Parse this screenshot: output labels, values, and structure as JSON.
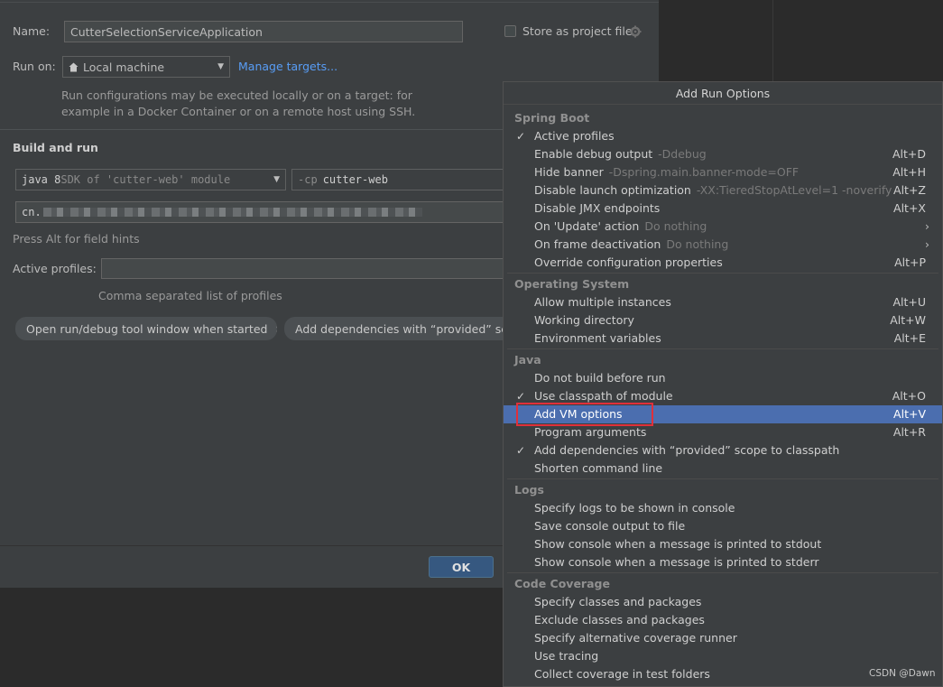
{
  "form": {
    "name_label": "Name:",
    "name_value": "CutterSelectionServiceApplication",
    "store_project_file": "Store as project file",
    "run_on_label": "Run on:",
    "run_on_value": "Local machine",
    "manage_targets": "Manage targets...",
    "run_on_hint": [
      "Run configurations may be executed locally or on a target: for",
      "example in a Docker Container or on a remote host using SSH."
    ],
    "build_and_run": "Build and run",
    "jdk_main": "java 8",
    "jdk_rest": " SDK of 'cutter-web' module",
    "cp_flag": "-cp",
    "cp_value": "cutter-web",
    "main_class_prefix": "cn.",
    "field_hint": "Press Alt for field hints",
    "active_profiles_label": "Active profiles:",
    "active_profiles_value": "",
    "profiles_hint": "Comma separated list of profiles",
    "chips": [
      "Open run/debug tool window when started",
      "Add dependencies with “provided” scope"
    ],
    "chip_close": "×",
    "ok": "OK"
  },
  "popup": {
    "title": "Add Run Options",
    "groups": [
      {
        "name": "Spring Boot",
        "items": [
          {
            "check": true,
            "label": "Active profiles",
            "hint": "",
            "shortcut": ""
          },
          {
            "check": false,
            "label": "Enable debug output",
            "hint": "-Ddebug",
            "shortcut": "Alt+D"
          },
          {
            "check": false,
            "label": "Hide banner",
            "hint": "-Dspring.main.banner-mode=OFF",
            "shortcut": "Alt+H"
          },
          {
            "check": false,
            "label": "Disable launch optimization",
            "hint": "-XX:TieredStopAtLevel=1 -noverify",
            "shortcut": "Alt+Z"
          },
          {
            "check": false,
            "label": "Disable JMX endpoints",
            "hint": "",
            "shortcut": "Alt+X"
          },
          {
            "check": false,
            "label": "On 'Update' action",
            "hint": "Do nothing",
            "shortcut": "",
            "submenu": true
          },
          {
            "check": false,
            "label": "On frame deactivation",
            "hint": "Do nothing",
            "shortcut": "",
            "submenu": true
          },
          {
            "check": false,
            "label": "Override configuration properties",
            "hint": "",
            "shortcut": "Alt+P"
          }
        ]
      },
      {
        "name": "Operating System",
        "items": [
          {
            "check": false,
            "label": "Allow multiple instances",
            "hint": "",
            "shortcut": "Alt+U"
          },
          {
            "check": false,
            "label": "Working directory",
            "hint": "",
            "shortcut": "Alt+W"
          },
          {
            "check": false,
            "label": "Environment variables",
            "hint": "",
            "shortcut": "Alt+E"
          }
        ]
      },
      {
        "name": "Java",
        "items": [
          {
            "check": false,
            "label": "Do not build before run",
            "hint": "",
            "shortcut": ""
          },
          {
            "check": true,
            "label": "Use classpath of module",
            "hint": "",
            "shortcut": "Alt+O"
          },
          {
            "check": false,
            "label": "Add VM options",
            "hint": "",
            "shortcut": "Alt+V",
            "selected": true
          },
          {
            "check": false,
            "label": "Program arguments",
            "hint": "",
            "shortcut": "Alt+R"
          },
          {
            "check": true,
            "label": "Add dependencies with “provided” scope to classpath",
            "hint": "",
            "shortcut": ""
          },
          {
            "check": false,
            "label": "Shorten command line",
            "hint": "",
            "shortcut": ""
          }
        ]
      },
      {
        "name": "Logs",
        "items": [
          {
            "check": false,
            "label": "Specify logs to be shown in console",
            "hint": "",
            "shortcut": ""
          },
          {
            "check": false,
            "label": "Save console output to file",
            "hint": "",
            "shortcut": ""
          },
          {
            "check": false,
            "label": "Show console when a message is printed to stdout",
            "hint": "",
            "shortcut": ""
          },
          {
            "check": false,
            "label": "Show console when a message is printed to stderr",
            "hint": "",
            "shortcut": ""
          }
        ]
      },
      {
        "name": "Code Coverage",
        "items": [
          {
            "check": false,
            "label": "Specify classes and packages",
            "hint": "",
            "shortcut": ""
          },
          {
            "check": false,
            "label": "Exclude classes and packages",
            "hint": "",
            "shortcut": ""
          },
          {
            "check": false,
            "label": "Specify alternative coverage runner",
            "hint": "",
            "shortcut": ""
          },
          {
            "check": false,
            "label": "Use tracing",
            "hint": "",
            "shortcut": ""
          },
          {
            "check": false,
            "label": "Collect coverage in test folders",
            "hint": "",
            "shortcut": ""
          }
        ]
      }
    ]
  },
  "watermark": "CSDN @Dawn",
  "glyphs": {
    "check": "✓",
    "submenu_arrow": "›",
    "dropdown": "▼",
    "home_icon": "home-icon",
    "gear_icon": "gear-icon"
  }
}
